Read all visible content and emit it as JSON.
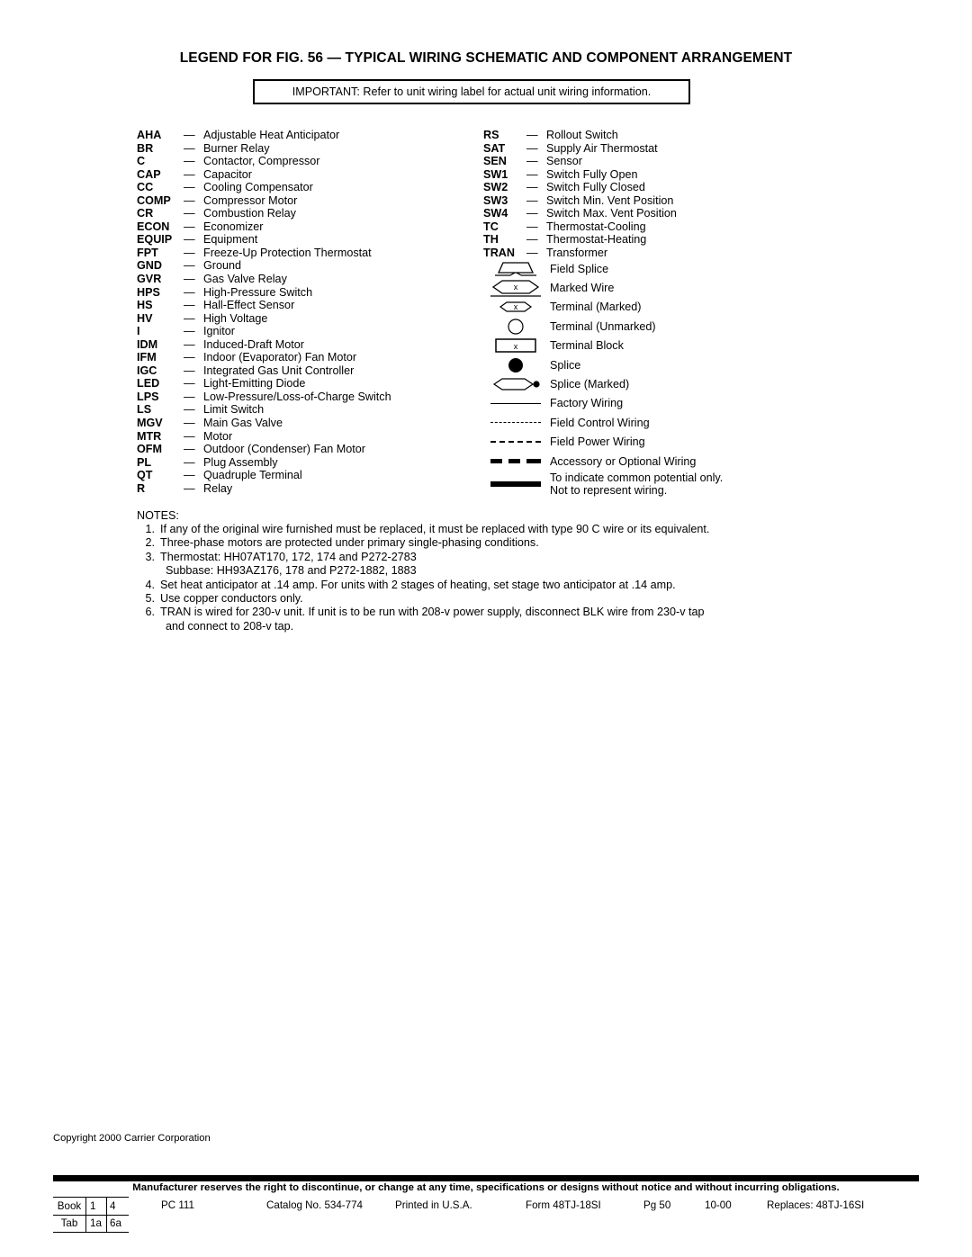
{
  "page": {
    "title": "LEGEND FOR FIG. 56 — TYPICAL WIRING SCHEMATIC AND COMPONENT ARRANGEMENT",
    "important_note": "IMPORTANT: Refer to unit wiring label for actual unit wiring information."
  },
  "legend": {
    "dash": "—",
    "left_column": [
      {
        "abbr": "AHA",
        "desc": "Adjustable Heat Anticipator"
      },
      {
        "abbr": "BR",
        "desc": "Burner Relay"
      },
      {
        "abbr": "C",
        "desc": "Contactor, Compressor"
      },
      {
        "abbr": "CAP",
        "desc": "Capacitor"
      },
      {
        "abbr": "CC",
        "desc": "Cooling Compensator"
      },
      {
        "abbr": "COMP",
        "desc": "Compressor Motor"
      },
      {
        "abbr": "CR",
        "desc": "Combustion Relay"
      },
      {
        "abbr": "ECON",
        "desc": "Economizer"
      },
      {
        "abbr": "EQUIP",
        "desc": "Equipment"
      },
      {
        "abbr": "FPT",
        "desc": "Freeze-Up Protection Thermostat"
      },
      {
        "abbr": "GND",
        "desc": "Ground"
      },
      {
        "abbr": "GVR",
        "desc": "Gas Valve Relay"
      },
      {
        "abbr": "HPS",
        "desc": "High-Pressure Switch"
      },
      {
        "abbr": "HS",
        "desc": "Hall-Effect Sensor"
      },
      {
        "abbr": "HV",
        "desc": "High Voltage"
      },
      {
        "abbr": "I",
        "desc": "Ignitor"
      },
      {
        "abbr": "IDM",
        "desc": "Induced-Draft Motor"
      },
      {
        "abbr": "IFM",
        "desc": "Indoor (Evaporator) Fan Motor"
      },
      {
        "abbr": "IGC",
        "desc": "Integrated Gas Unit Controller"
      },
      {
        "abbr": "LED",
        "desc": "Light-Emitting Diode"
      },
      {
        "abbr": "LPS",
        "desc": "Low-Pressure/Loss-of-Charge Switch"
      },
      {
        "abbr": "LS",
        "desc": "Limit Switch"
      },
      {
        "abbr": "MGV",
        "desc": "Main Gas Valve"
      },
      {
        "abbr": "MTR",
        "desc": "Motor"
      },
      {
        "abbr": "OFM",
        "desc": "Outdoor (Condenser) Fan Motor"
      },
      {
        "abbr": "PL",
        "desc": "Plug Assembly"
      },
      {
        "abbr": "QT",
        "desc": "Quadruple Terminal"
      },
      {
        "abbr": "R",
        "desc": "Relay"
      }
    ],
    "right_column": [
      {
        "abbr": "RS",
        "desc": "Rollout Switch"
      },
      {
        "abbr": "SAT",
        "desc": "Supply Air Thermostat"
      },
      {
        "abbr": "SEN",
        "desc": "Sensor"
      },
      {
        "abbr": "SW1",
        "desc": "Switch Fully Open"
      },
      {
        "abbr": "SW2",
        "desc": "Switch Fully Closed"
      },
      {
        "abbr": "SW3",
        "desc": "Switch Min. Vent Position"
      },
      {
        "abbr": "SW4",
        "desc": "Switch Max. Vent Position"
      },
      {
        "abbr": "TC",
        "desc": "Thermostat-Cooling"
      },
      {
        "abbr": "TH",
        "desc": "Thermostat-Heating"
      },
      {
        "abbr": "TRAN",
        "desc": "Transformer"
      }
    ]
  },
  "symbols": [
    {
      "icon": "field-splice-icon",
      "label": "Field Splice",
      "marker": ""
    },
    {
      "icon": "marked-wire-icon",
      "label": "Marked Wire",
      "marker": "x"
    },
    {
      "icon": "terminal-marked-icon",
      "label": "Terminal (Marked)",
      "marker": "x"
    },
    {
      "icon": "terminal-unmarked-icon",
      "label": "Terminal (Unmarked)",
      "marker": ""
    },
    {
      "icon": "terminal-block-icon",
      "label": "Terminal Block",
      "marker": "x"
    },
    {
      "icon": "splice-icon",
      "label": "Splice",
      "marker": ""
    },
    {
      "icon": "splice-marked-icon",
      "label": "Splice (Marked)",
      "marker": ""
    },
    {
      "icon": "factory-wiring-icon",
      "label": "Factory Wiring",
      "marker": ""
    },
    {
      "icon": "field-control-wiring-icon",
      "label": "Field Control Wiring",
      "marker": ""
    },
    {
      "icon": "field-power-wiring-icon",
      "label": "Field Power Wiring",
      "marker": ""
    },
    {
      "icon": "accessory-wiring-icon",
      "label": "Accessory or Optional Wiring",
      "marker": ""
    },
    {
      "icon": "common-potential-icon",
      "label_line1": "To indicate common potential only.",
      "label_line2": "Not to represent wiring.",
      "marker": ""
    }
  ],
  "notes": {
    "heading": "NOTES:",
    "items": [
      {
        "num": "1.",
        "text": "If any of the original wire furnished must be replaced, it must be replaced with type 90 C wire or its equivalent."
      },
      {
        "num": "2.",
        "text": "Three-phase motors are protected under primary single-phasing conditions."
      },
      {
        "num": "3.",
        "text": "Thermostat: HH07AT170, 172, 174 and P272-2783",
        "sub": "Subbase: HH93AZ176, 178 and P272-1882, 1883"
      },
      {
        "num": "4.",
        "text": "Set heat anticipator at .14 amp. For units with 2 stages of heating, set stage two anticipator at .14 amp."
      },
      {
        "num": "5.",
        "text": "Use copper conductors only."
      },
      {
        "num": "6.",
        "text": "TRAN is wired for 230-v unit. If unit is to be run with 208-v power supply, disconnect BLK wire from 230-v tap",
        "cont": "and connect to 208-v tap."
      }
    ]
  },
  "footer": {
    "copyright": "Copyright 2000 Carrier Corporation",
    "manufacturer_statement": "Manufacturer reserves the right to discontinue, or change at any time, specifications or designs without notice and without incurring obligations.",
    "booktab": {
      "row1_label": "Book",
      "row1_c2": "1",
      "row1_c3": "4",
      "row2_label": "Tab",
      "row2_c2": "1a",
      "row2_c3": "6a"
    },
    "meta": {
      "pc": "PC 111",
      "catalog": "Catalog No. 534-774",
      "printed": "Printed in U.S.A.",
      "form": "Form 48TJ-18SI",
      "page": "Pg 50",
      "date": "10-00",
      "replaces": "Replaces: 48TJ-16SI"
    }
  }
}
